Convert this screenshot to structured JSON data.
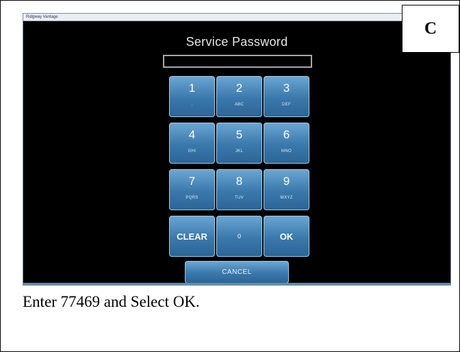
{
  "window": {
    "title": "Ridgway Vantage"
  },
  "dialog": {
    "title": "Service Password",
    "password_value": ""
  },
  "keypad": {
    "keys": [
      {
        "digit": "1",
        "letters": "."
      },
      {
        "digit": "2",
        "letters": "ABC"
      },
      {
        "digit": "3",
        "letters": "DEF"
      },
      {
        "digit": "4",
        "letters": "GHI"
      },
      {
        "digit": "5",
        "letters": "JKL"
      },
      {
        "digit": "6",
        "letters": "MNO"
      },
      {
        "digit": "7",
        "letters": "PQRS"
      },
      {
        "digit": "8",
        "letters": "TUV"
      },
      {
        "digit": "9",
        "letters": "WXYZ"
      }
    ],
    "clear_label": "CLEAR",
    "zero_label": "0",
    "ok_label": "OK",
    "cancel_label": "CANCEL"
  },
  "panel_label": "C",
  "caption": "Enter 77469 and Select OK.",
  "colors": {
    "key_blue": "#3a78ac",
    "screen_bg": "#000000",
    "title_text": "#e6e6e6"
  }
}
